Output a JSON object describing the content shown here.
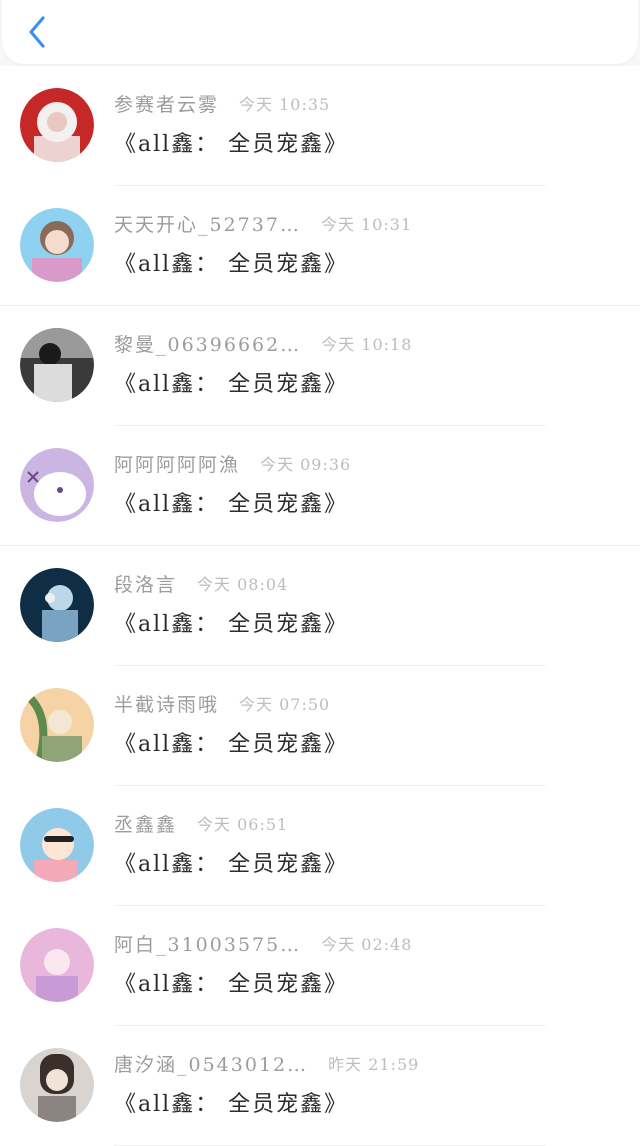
{
  "header": {
    "back_icon": "chevron-left-icon",
    "accent": "#3b8ff6"
  },
  "items": [
    {
      "name": "参赛者云雾",
      "time": "今天 10:35",
      "comment": "《all鑫： 全员宠鑫》",
      "avatar_colors": [
        "#c62828",
        "#f3f0f0"
      ]
    },
    {
      "name": "天天开心_52737…",
      "time": "今天 10:31",
      "comment": "《all鑫： 全员宠鑫》",
      "avatar_colors": [
        "#8fd1f0",
        "#d89ac8"
      ]
    },
    {
      "name": "黎曼_063966​62…",
      "time": "今天 10:18",
      "comment": "《all鑫： 全员宠鑫》",
      "avatar_colors": [
        "#3a3a3a",
        "#dcdcdc"
      ]
    },
    {
      "name": "阿阿阿阿阿漁",
      "time": "今天 09:36",
      "comment": "《all鑫： 全员宠鑫》",
      "avatar_colors": [
        "#cbb6e3",
        "#ffffff"
      ]
    },
    {
      "name": "段洛言",
      "time": "今天 08:04",
      "comment": "《all鑫： 全员宠鑫》",
      "avatar_colors": [
        "#0f2d44",
        "#bcd7e6"
      ]
    },
    {
      "name": "半截诗雨哦",
      "time": "今天 07:50",
      "comment": "《all鑫： 全员宠鑫》",
      "avatar_colors": [
        "#f5d3a4",
        "#8fa577"
      ]
    },
    {
      "name": "丞鑫鑫",
      "time": "今天 06:51",
      "comment": "《all鑫： 全员宠鑫》",
      "avatar_colors": [
        "#8fcbe8",
        "#f3a9b8"
      ]
    },
    {
      "name": "阿白_31003575…",
      "time": "今天 02:48",
      "comment": "《all鑫： 全员宠鑫》",
      "avatar_colors": [
        "#e9b6dc",
        "#c89ad6"
      ]
    },
    {
      "name": "唐汐涵_0543012…",
      "time": "昨天 21:59",
      "comment": "《all鑫： 全员宠鑫》",
      "avatar_colors": [
        "#d9d4d0",
        "#8c8480"
      ]
    }
  ]
}
